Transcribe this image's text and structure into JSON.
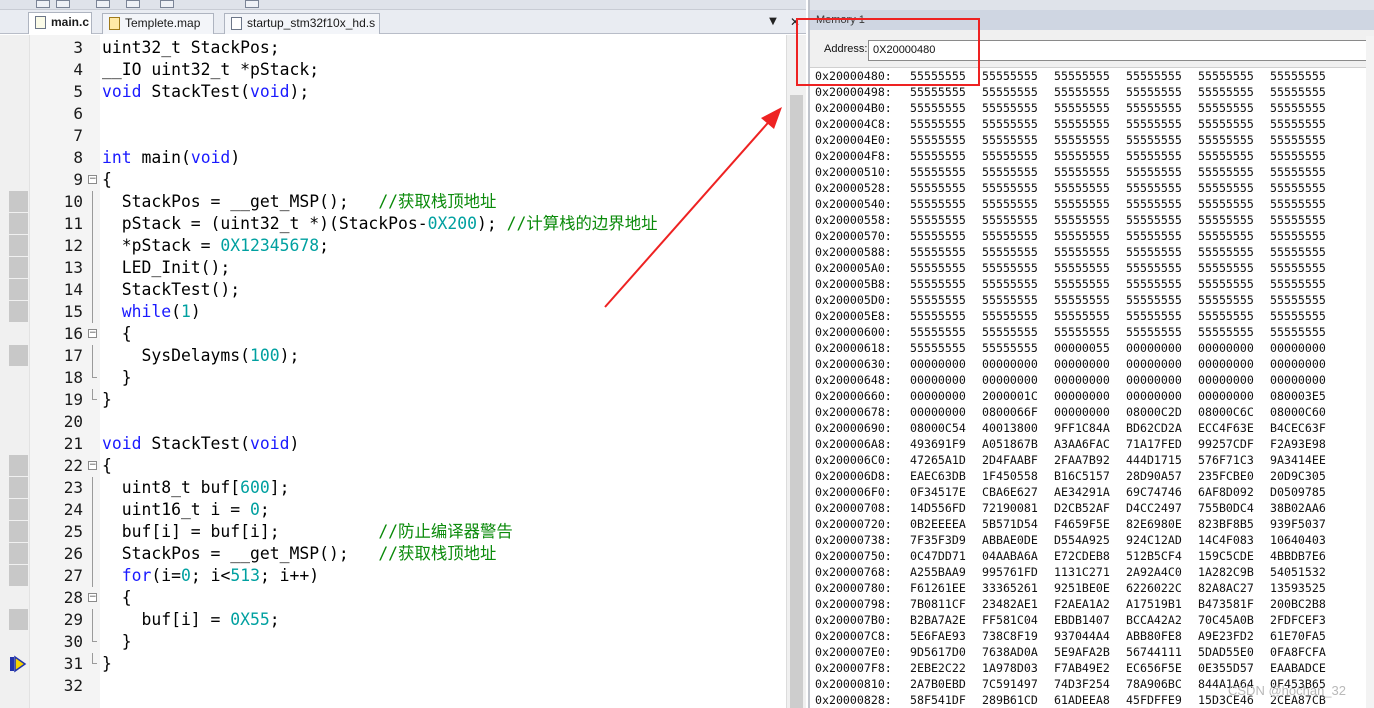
{
  "tabs": [
    {
      "label": "main.c",
      "icon": "c-file-icon",
      "active": true
    },
    {
      "label": "Templete.map",
      "icon": "map-file-icon",
      "active": false
    },
    {
      "label": "startup_stm32f10x_hd.s",
      "icon": "asm-file-icon",
      "active": false
    }
  ],
  "tab_menu_glyph": "▼",
  "close_glyph": "✕",
  "code_lines": [
    {
      "n": "3",
      "fold": "",
      "mark": false,
      "html": "uint32_t StackPos;"
    },
    {
      "n": "4",
      "fold": "",
      "mark": false,
      "html": "__IO uint32_t *pStack;"
    },
    {
      "n": "5",
      "fold": "",
      "mark": false,
      "html": "<span class='kw'>void</span> StackTest(<span class='kw'>void</span>);"
    },
    {
      "n": "6",
      "fold": "",
      "mark": false,
      "html": ""
    },
    {
      "n": "7",
      "fold": "",
      "mark": false,
      "html": ""
    },
    {
      "n": "8",
      "fold": "",
      "mark": false,
      "html": "<span class='kw'>int</span> main(<span class='kw'>void</span>)"
    },
    {
      "n": "9",
      "fold": "open",
      "mark": false,
      "html": "{"
    },
    {
      "n": "10",
      "fold": "line",
      "mark": true,
      "html": "  StackPos = __get_MSP();   <span class='cm'>//获取栈顶地址</span>"
    },
    {
      "n": "11",
      "fold": "line",
      "mark": true,
      "html": "  pStack = (uint32_t *)(StackPos-<span class='num'>0X200</span>); <span class='cm'>//计算栈的边界地址</span>"
    },
    {
      "n": "12",
      "fold": "line",
      "mark": true,
      "html": "  *pStack = <span class='num'>0X12345678</span>;"
    },
    {
      "n": "13",
      "fold": "line",
      "mark": true,
      "html": "  LED_Init();"
    },
    {
      "n": "14",
      "fold": "line",
      "mark": true,
      "html": "  StackTest();"
    },
    {
      "n": "15",
      "fold": "line",
      "mark": true,
      "html": "  <span class='kw'>while</span>(<span class='num'>1</span>)"
    },
    {
      "n": "16",
      "fold": "open",
      "mark": false,
      "html": "  {"
    },
    {
      "n": "17",
      "fold": "line",
      "mark": true,
      "html": "    SysDelayms(<span class='num'>100</span>);"
    },
    {
      "n": "18",
      "fold": "end",
      "mark": false,
      "html": "  }"
    },
    {
      "n": "19",
      "fold": "end",
      "mark": false,
      "html": "}"
    },
    {
      "n": "20",
      "fold": "",
      "mark": false,
      "html": ""
    },
    {
      "n": "21",
      "fold": "",
      "mark": false,
      "html": "<span class='kw'>void</span> StackTest(<span class='kw'>void</span>)"
    },
    {
      "n": "22",
      "fold": "open",
      "mark": true,
      "html": "{"
    },
    {
      "n": "23",
      "fold": "line",
      "mark": true,
      "html": "  uint8_t buf[<span class='num'>600</span>];"
    },
    {
      "n": "24",
      "fold": "line",
      "mark": true,
      "html": "  uint16_t i = <span class='num'>0</span>;"
    },
    {
      "n": "25",
      "fold": "line",
      "mark": true,
      "html": "  buf[i] = buf[i];          <span class='cm'>//防止编译器警告</span>"
    },
    {
      "n": "26",
      "fold": "line",
      "mark": true,
      "html": "  StackPos = __get_MSP();   <span class='cm'>//获取栈顶地址</span>"
    },
    {
      "n": "27",
      "fold": "line",
      "mark": true,
      "html": "  <span class='kw'>for</span>(i=<span class='num'>0</span>; i&lt;<span class='num'>513</span>; i++)"
    },
    {
      "n": "28",
      "fold": "open",
      "mark": false,
      "html": "  {"
    },
    {
      "n": "29",
      "fold": "line",
      "mark": true,
      "html": "    buf[i] = <span class='num'>0X55</span>;"
    },
    {
      "n": "30",
      "fold": "end",
      "mark": false,
      "html": "  }"
    },
    {
      "n": "31",
      "fold": "end",
      "mark": false,
      "html": "}"
    },
    {
      "n": "32",
      "fold": "",
      "mark": false,
      "html": ""
    }
  ],
  "memory": {
    "title": "Memory 1",
    "address_label": "Address:",
    "address_value": "0X20000480",
    "rows": [
      {
        "addr": "0x20000480:",
        "words": [
          "55555555",
          "55555555",
          "55555555",
          "55555555",
          "55555555",
          "55555555"
        ]
      },
      {
        "addr": "0x20000498:",
        "words": [
          "55555555",
          "55555555",
          "55555555",
          "55555555",
          "55555555",
          "55555555"
        ]
      },
      {
        "addr": "0x200004B0:",
        "words": [
          "55555555",
          "55555555",
          "55555555",
          "55555555",
          "55555555",
          "55555555"
        ]
      },
      {
        "addr": "0x200004C8:",
        "words": [
          "55555555",
          "55555555",
          "55555555",
          "55555555",
          "55555555",
          "55555555"
        ]
      },
      {
        "addr": "0x200004E0:",
        "words": [
          "55555555",
          "55555555",
          "55555555",
          "55555555",
          "55555555",
          "55555555"
        ]
      },
      {
        "addr": "0x200004F8:",
        "words": [
          "55555555",
          "55555555",
          "55555555",
          "55555555",
          "55555555",
          "55555555"
        ]
      },
      {
        "addr": "0x20000510:",
        "words": [
          "55555555",
          "55555555",
          "55555555",
          "55555555",
          "55555555",
          "55555555"
        ]
      },
      {
        "addr": "0x20000528:",
        "words": [
          "55555555",
          "55555555",
          "55555555",
          "55555555",
          "55555555",
          "55555555"
        ]
      },
      {
        "addr": "0x20000540:",
        "words": [
          "55555555",
          "55555555",
          "55555555",
          "55555555",
          "55555555",
          "55555555"
        ]
      },
      {
        "addr": "0x20000558:",
        "words": [
          "55555555",
          "55555555",
          "55555555",
          "55555555",
          "55555555",
          "55555555"
        ]
      },
      {
        "addr": "0x20000570:",
        "words": [
          "55555555",
          "55555555",
          "55555555",
          "55555555",
          "55555555",
          "55555555"
        ]
      },
      {
        "addr": "0x20000588:",
        "words": [
          "55555555",
          "55555555",
          "55555555",
          "55555555",
          "55555555",
          "55555555"
        ]
      },
      {
        "addr": "0x200005A0:",
        "words": [
          "55555555",
          "55555555",
          "55555555",
          "55555555",
          "55555555",
          "55555555"
        ]
      },
      {
        "addr": "0x200005B8:",
        "words": [
          "55555555",
          "55555555",
          "55555555",
          "55555555",
          "55555555",
          "55555555"
        ]
      },
      {
        "addr": "0x200005D0:",
        "words": [
          "55555555",
          "55555555",
          "55555555",
          "55555555",
          "55555555",
          "55555555"
        ]
      },
      {
        "addr": "0x200005E8:",
        "words": [
          "55555555",
          "55555555",
          "55555555",
          "55555555",
          "55555555",
          "55555555"
        ]
      },
      {
        "addr": "0x20000600:",
        "words": [
          "55555555",
          "55555555",
          "55555555",
          "55555555",
          "55555555",
          "55555555"
        ]
      },
      {
        "addr": "0x20000618:",
        "words": [
          "55555555",
          "55555555",
          "00000055",
          "00000000",
          "00000000",
          "00000000"
        ]
      },
      {
        "addr": "0x20000630:",
        "words": [
          "00000000",
          "00000000",
          "00000000",
          "00000000",
          "00000000",
          "00000000"
        ]
      },
      {
        "addr": "0x20000648:",
        "words": [
          "00000000",
          "00000000",
          "00000000",
          "00000000",
          "00000000",
          "00000000"
        ]
      },
      {
        "addr": "0x20000660:",
        "words": [
          "00000000",
          "2000001C",
          "00000000",
          "00000000",
          "00000000",
          "080003E5"
        ]
      },
      {
        "addr": "0x20000678:",
        "words": [
          "00000000",
          "0800066F",
          "00000000",
          "08000C2D",
          "08000C6C",
          "08000C60"
        ]
      },
      {
        "addr": "0x20000690:",
        "words": [
          "08000C54",
          "40013800",
          "9FF1C84A",
          "BD62CD2A",
          "ECC4F63E",
          "B4CEC63F"
        ]
      },
      {
        "addr": "0x200006A8:",
        "words": [
          "493691F9",
          "A051867B",
          "A3AA6FAC",
          "71A17FED",
          "99257CDF",
          "F2A93E98"
        ]
      },
      {
        "addr": "0x200006C0:",
        "words": [
          "47265A1D",
          "2D4FAABF",
          "2FAA7B92",
          "444D1715",
          "576F71C3",
          "9A3414EE"
        ]
      },
      {
        "addr": "0x200006D8:",
        "words": [
          "EAEC63DB",
          "1F450558",
          "B16C5157",
          "28D90A57",
          "235FCBE0",
          "20D9C305"
        ]
      },
      {
        "addr": "0x200006F0:",
        "words": [
          "0F34517E",
          "CBA6E627",
          "AE34291A",
          "69C74746",
          "6AF8D092",
          "D0509785"
        ]
      },
      {
        "addr": "0x20000708:",
        "words": [
          "14D556FD",
          "72190081",
          "D2CB52AF",
          "D4CC2497",
          "755B0DC4",
          "38B02AA6"
        ]
      },
      {
        "addr": "0x20000720:",
        "words": [
          "0B2EEEEA",
          "5B571D54",
          "F4659F5E",
          "82E6980E",
          "823BF8B5",
          "939F5037"
        ]
      },
      {
        "addr": "0x20000738:",
        "words": [
          "7F35F3D9",
          "ABBAE0DE",
          "D554A925",
          "924C12AD",
          "14C4F083",
          "10640403"
        ]
      },
      {
        "addr": "0x20000750:",
        "words": [
          "0C47DD71",
          "04AABA6A",
          "E72CDEB8",
          "512B5CF4",
          "159C5CDE",
          "4BBDB7E6"
        ]
      },
      {
        "addr": "0x20000768:",
        "words": [
          "A255BAA9",
          "995761FD",
          "1131C271",
          "2A92A4C0",
          "1A282C9B",
          "54051532"
        ]
      },
      {
        "addr": "0x20000780:",
        "words": [
          "F61261EE",
          "33365261",
          "9251BE0E",
          "6226022C",
          "82A8AC27",
          "13593525"
        ]
      },
      {
        "addr": "0x20000798:",
        "words": [
          "7B0811CF",
          "23482AE1",
          "F2AEA1A2",
          "A17519B1",
          "B473581F",
          "200BC2B8"
        ]
      },
      {
        "addr": "0x200007B0:",
        "words": [
          "B2BA7A2E",
          "FF581C04",
          "EBDB1407",
          "BCCA42A2",
          "70C45A0B",
          "2FDFCEF3"
        ]
      },
      {
        "addr": "0x200007C8:",
        "words": [
          "5E6FAE93",
          "738C8F19",
          "937044A4",
          "ABB80FE8",
          "A9E23FD2",
          "61E70FA5"
        ]
      },
      {
        "addr": "0x200007E0:",
        "words": [
          "9D5617D0",
          "7638AD0A",
          "5E9AFA2B",
          "56744111",
          "5DAD55E0",
          "0FA8FCFA"
        ]
      },
      {
        "addr": "0x200007F8:",
        "words": [
          "2EBE2C22",
          "1A978D03",
          "F7AB49E2",
          "EC656F5E",
          "0E355D57",
          "EAABADCE"
        ]
      },
      {
        "addr": "0x20000810:",
        "words": [
          "2A7B0EBD",
          "7C591497",
          "74D3F254",
          "78A906BC",
          "844A1A64",
          "0F453B65"
        ]
      },
      {
        "addr": "0x20000828:",
        "words": [
          "58F541DF",
          "289B61CD",
          "61ADEEA8",
          "45FDFFE9",
          "15D3CE46",
          "2CEA87CB"
        ]
      }
    ]
  },
  "watermark": "CSDN @hochan_32",
  "colors": {
    "annotation": "#ee2222",
    "keyword": "#1a1aff",
    "number": "#00a0a0",
    "comment": "#0a8a0a"
  }
}
